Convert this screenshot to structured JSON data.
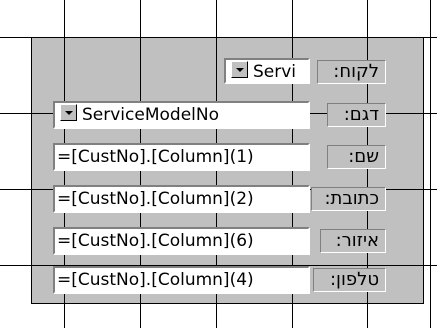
{
  "form": {
    "rows": [
      {
        "label": "לקוח:",
        "value": "Servi",
        "has_dropdown": true
      },
      {
        "label": "דגם:",
        "value": "ServiceModelNo",
        "has_dropdown": true
      },
      {
        "label": "שם:",
        "value": "=[CustNo].[Column](1)",
        "has_dropdown": false
      },
      {
        "label": "כתובת:",
        "value": "=[CustNo].[Column](2)",
        "has_dropdown": false
      },
      {
        "label": "איזור:",
        "value": "=[CustNo].[Column](6)",
        "has_dropdown": false
      },
      {
        "label": "טלפון:",
        "value": "=[CustNo].[Column](4)",
        "has_dropdown": false
      }
    ]
  },
  "icons": {
    "dropdown": "chevron-down-icon"
  },
  "colors": {
    "background": "#c0c0c0",
    "field": "#ffffff",
    "grid": "#000000"
  }
}
